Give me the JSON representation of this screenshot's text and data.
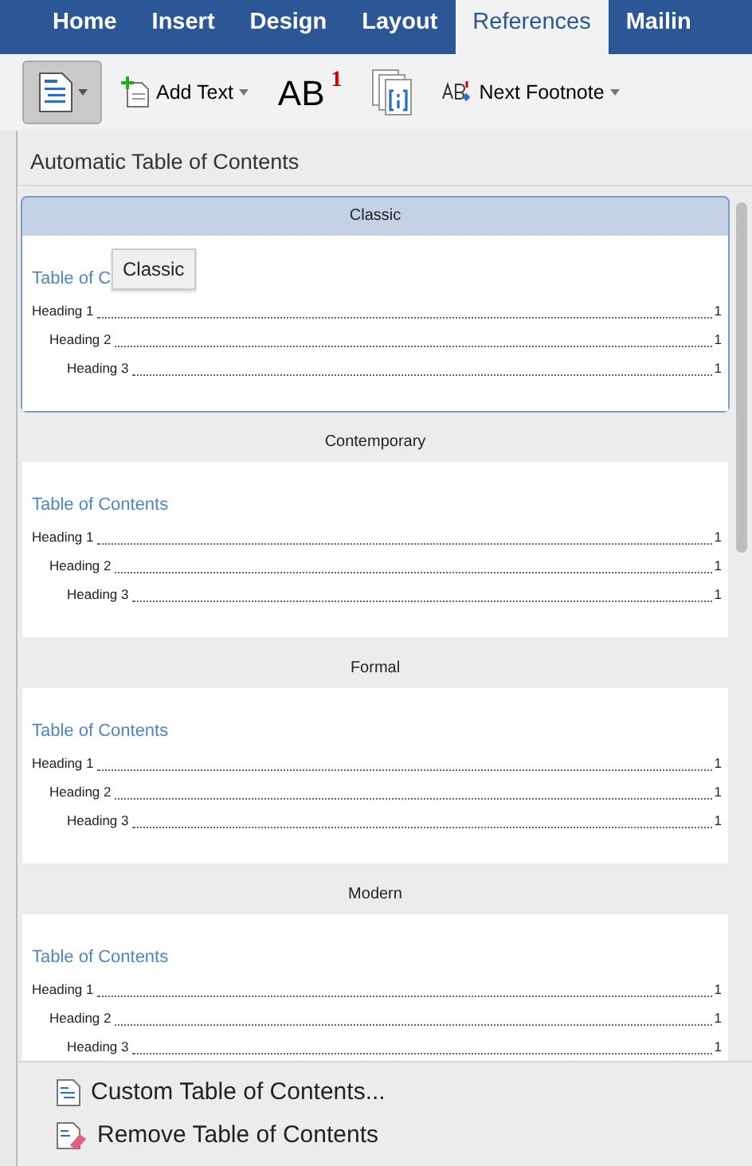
{
  "ribbon_tabs": [
    {
      "label": "Home",
      "selected": false
    },
    {
      "label": "Insert",
      "selected": false
    },
    {
      "label": "Design",
      "selected": false
    },
    {
      "label": "Layout",
      "selected": false
    },
    {
      "label": "References",
      "selected": true
    },
    {
      "label": "Mailin",
      "selected": false
    }
  ],
  "toolbar": {
    "add_text": "Add Text",
    "insert_footnote": "AB",
    "footnote_mark": "1",
    "next_footnote": "Next Footnote"
  },
  "gallery": {
    "header": "Automatic Table of Contents",
    "items": [
      {
        "name": "Classic",
        "selected": true,
        "title": "Table of C",
        "entries": [
          "Heading 1",
          "Heading 2",
          "Heading 3"
        ],
        "pages": [
          "1",
          "1",
          "1"
        ]
      },
      {
        "name": "Contemporary",
        "selected": false,
        "title": "Table of Contents",
        "entries": [
          "Heading 1",
          "Heading 2",
          "Heading 3"
        ],
        "pages": [
          "1",
          "1",
          "1"
        ]
      },
      {
        "name": "Formal",
        "selected": false,
        "title": "Table of Contents",
        "entries": [
          "Heading 1",
          "Heading 2",
          "Heading 3"
        ],
        "pages": [
          "1",
          "1",
          "1"
        ]
      },
      {
        "name": "Modern",
        "selected": false,
        "title": "Table of Contents",
        "entries": [
          "Heading 1",
          "Heading 2",
          "Heading 3"
        ],
        "pages": [
          "1",
          "1",
          "1"
        ]
      }
    ],
    "tooltip": "Classic"
  },
  "menu_items": [
    {
      "kind": "custom",
      "label": "Custom Table of Contents..."
    },
    {
      "kind": "remove",
      "label": "Remove Table of Contents"
    }
  ]
}
